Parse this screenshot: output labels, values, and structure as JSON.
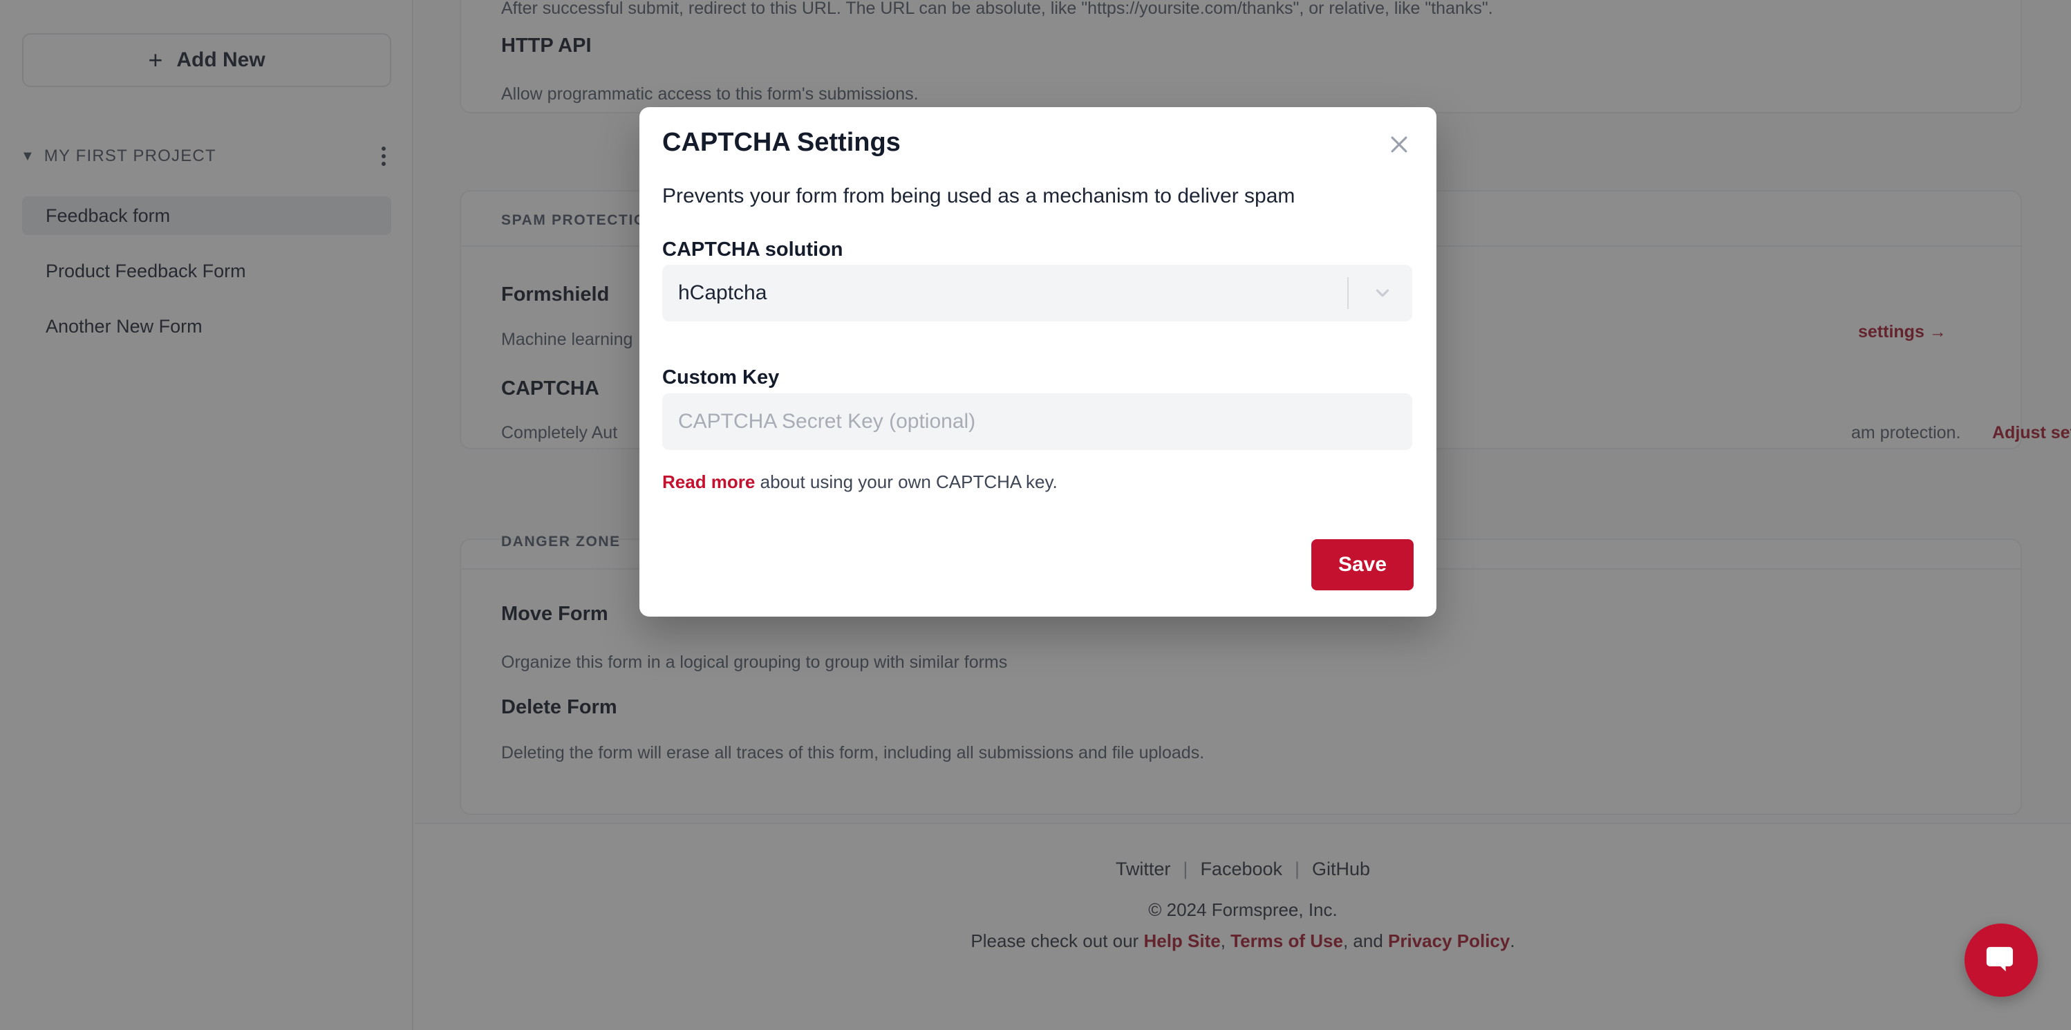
{
  "sidebar": {
    "add_new_label": "Add New",
    "add_icon": "plus-icon",
    "project": {
      "name": "MY FIRST PROJECT",
      "caret": "▼",
      "menu_icon": "kebab-menu-icon"
    },
    "forms": [
      {
        "label": "Feedback form",
        "active": true
      },
      {
        "label": "Product Feedback Form",
        "active": false
      },
      {
        "label": "Another New Form",
        "active": false
      }
    ]
  },
  "main": {
    "redirect_desc": "After successful submit, redirect to this URL. The URL can be absolute, like \"https://yoursite.com/thanks\", or relative, like \"thanks\".",
    "http_api": {
      "title": "HTTP API",
      "desc": "Allow programmatic access to this form's submissions.",
      "toggle_state": "off"
    },
    "spam_section": {
      "label": "SPAM PROTECTION",
      "rows": [
        {
          "title": "Formshield",
          "desc": "Machine learning",
          "link_text": "settings →",
          "toggle_state": "on"
        },
        {
          "title": "CAPTCHA",
          "desc": "Completely Aut",
          "desc_tail": "am protection.",
          "link_text": "Adjust settings →",
          "toggle_state": "on"
        }
      ]
    },
    "danger_section": {
      "label": "DANGER ZONE",
      "rows": [
        {
          "title": "Move Form",
          "desc": "Organize this form in a logical grouping to group with similar forms",
          "icon": "arrow-right-circle-icon"
        },
        {
          "title": "Delete Form",
          "desc": "Deleting the form will erase all traces of this form, including all submissions and file uploads.",
          "icon": "trash-icon"
        }
      ]
    }
  },
  "footer": {
    "social": [
      {
        "label": "Twitter"
      },
      {
        "label": "Facebook"
      },
      {
        "label": "GitHub"
      }
    ],
    "separator": "|",
    "copyright": "© 2024 Formspree, Inc.",
    "legal_prefix": "Please check out our ",
    "legal_links": [
      {
        "label": "Help Site"
      },
      {
        "label": "Terms of Use"
      },
      {
        "label": "Privacy Policy"
      }
    ],
    "legal_mid": ", ",
    "legal_and": ", and ",
    "legal_end": ".",
    "chat_icon": "chat-bubble-icon"
  },
  "modal": {
    "title": "CAPTCHA Settings",
    "close_icon": "close-icon",
    "subtitle": "Prevents your form from being used as a mechanism to deliver spam",
    "solution_label": "CAPTCHA solution",
    "solution_value": "hCaptcha",
    "solution_chevron_icon": "chevron-down-icon",
    "custom_key_label": "Custom Key",
    "custom_key_value": "",
    "custom_key_placeholder": "CAPTCHA Secret Key (optional)",
    "read_more_link": "Read more",
    "read_more_rest": " about using your own CAPTCHA key.",
    "save_label": "Save"
  },
  "colors": {
    "brand_red": "#c4112f",
    "link_red": "#a6192e",
    "dark": "#1d2433",
    "field_bg": "#f3f4f6"
  }
}
